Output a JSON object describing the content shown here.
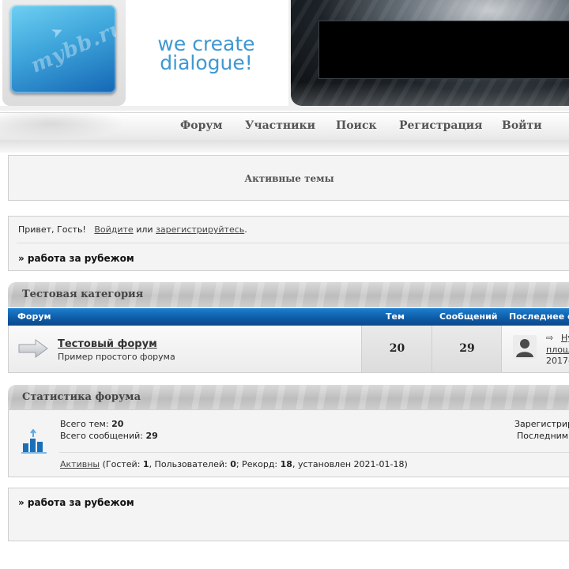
{
  "header": {
    "logo_text": "mybb.ru",
    "slogan_line1": "we create",
    "slogan_line2": "dialogue!"
  },
  "nav": {
    "items": [
      "Форум",
      "Участники",
      "Поиск",
      "Регистрация",
      "Войти"
    ]
  },
  "active_topics": {
    "title": "Активные темы"
  },
  "welcome": {
    "greeting": "Привет, Гость!",
    "login_link": "Войдите",
    "or": "или",
    "register_link": "зарегистрируйтесь",
    "period": ".",
    "breadcrumb": "» работа за рубежом"
  },
  "category": {
    "title": "Тестовая категория",
    "columns": {
      "forum": "Форум",
      "topics": "Тем",
      "posts": "Сообщений",
      "last": "Последнее с"
    },
    "forum": {
      "name": "Тестовый форум",
      "description": "Пример простого форума",
      "topics": "20",
      "posts": "29",
      "last_link_1": "Ну",
      "last_link_2": "площ",
      "last_date": "2017-"
    }
  },
  "stats": {
    "title": "Статистика форума",
    "topics_label": "Всего тем:",
    "topics_value": "20",
    "posts_label": "Всего сообщений:",
    "posts_value": "29",
    "right_line1": "Зарегистрир",
    "right_line2": "Последним",
    "online_link": "Активны",
    "online_guests_label": "(Гостей:",
    "online_guests": "1",
    "online_users_label": ", Пользователей:",
    "online_users": "0",
    "online_record_label": "; Рекорд:",
    "online_record": "18",
    "online_record_date": ", установлен 2021-01-18)"
  },
  "footer": {
    "breadcrumb": "» работа за рубежом"
  },
  "colors": {
    "accent_blue": "#0e5aa5",
    "slogan": "#3f98d1"
  }
}
